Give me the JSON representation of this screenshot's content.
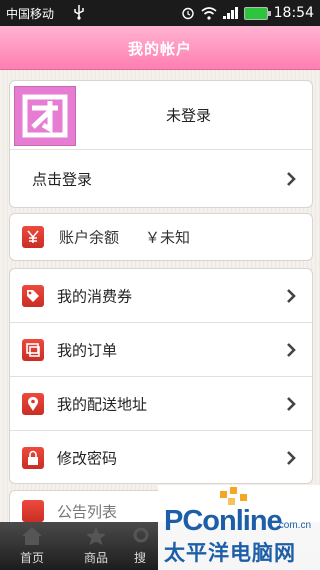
{
  "status_bar": {
    "carrier": "中国移动",
    "time": "18:54"
  },
  "header": {
    "title": "我的帐户"
  },
  "account": {
    "login_status": "未登录",
    "login_action": "点击登录"
  },
  "balance": {
    "label": "账户余额",
    "value": "￥未知"
  },
  "menu": {
    "items": [
      {
        "label": "我的消费券",
        "icon": "coupon-tag-icon"
      },
      {
        "label": "我的订单",
        "icon": "orders-icon"
      },
      {
        "label": "我的配送地址",
        "icon": "location-pin-icon"
      },
      {
        "label": "修改密码",
        "icon": "lock-icon"
      }
    ],
    "partial_item": "公告列表"
  },
  "tabbar": {
    "tabs": [
      {
        "label": "首页"
      },
      {
        "label": "商品"
      },
      {
        "label": "搜"
      }
    ]
  },
  "watermark": {
    "brand": "PConline",
    "domain": ".com.cn",
    "chinese": "太平洋电脑网"
  },
  "colors": {
    "header_pink": "#ff8fbd",
    "icon_red": "#d9362c",
    "logo_magenta": "#e67dd3",
    "battery_green": "#2cc53c"
  }
}
